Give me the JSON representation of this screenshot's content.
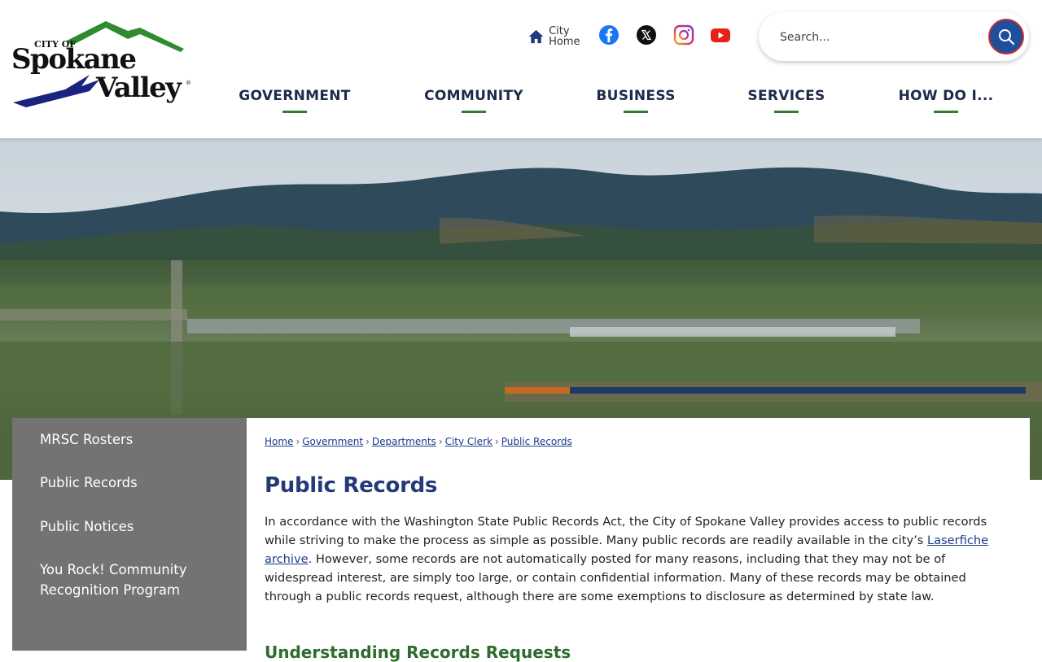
{
  "logo": {
    "city_of": "CITY OF",
    "word1": "Spokane",
    "word2": "Valley",
    "registered": "®"
  },
  "quick_links": {
    "home_label": "City Home",
    "social": [
      "facebook-icon",
      "x-twitter-icon",
      "instagram-icon",
      "youtube-icon"
    ]
  },
  "search": {
    "placeholder": "Search..."
  },
  "nav": {
    "items": [
      {
        "label": "GOVERNMENT"
      },
      {
        "label": "COMMUNITY"
      },
      {
        "label": "BUSINESS"
      },
      {
        "label": "SERVICES"
      },
      {
        "label": "HOW DO I..."
      }
    ]
  },
  "sidebar": {
    "items": [
      {
        "label": "MRSC Rosters"
      },
      {
        "label": "Public Records"
      },
      {
        "label": "Public Notices"
      },
      {
        "label": "You Rock! Community Recognition Program"
      }
    ]
  },
  "breadcrumb": {
    "items": [
      "Home",
      "Government",
      "Departments",
      "City Clerk",
      "Public Records"
    ],
    "separator": "›"
  },
  "page": {
    "title": "Public Records",
    "intro_before_link": "In accordance with the Washington State Public Records Act, the City of Spokane Valley provides access to public records while striving to make the process as simple as possible. Many public records are readily available in the city’s ",
    "intro_link": "Laserfiche archive",
    "intro_after_link": ". However, some records are not automatically posted for many reasons, including that they may not be of widespread interest, are simply too large, or contain confidential information. Many of these records may be obtained through a public records request, although there are some exemptions to disclosure as determined by state law.",
    "subheading": "Understanding Records Requests"
  },
  "colors": {
    "nav_text": "#1e2a4a",
    "nav_accent": "#2e7d32",
    "title": "#243a78",
    "link": "#1a3a8a",
    "sidebar_bg": "#737373",
    "search_button": "#1f4e9c"
  }
}
